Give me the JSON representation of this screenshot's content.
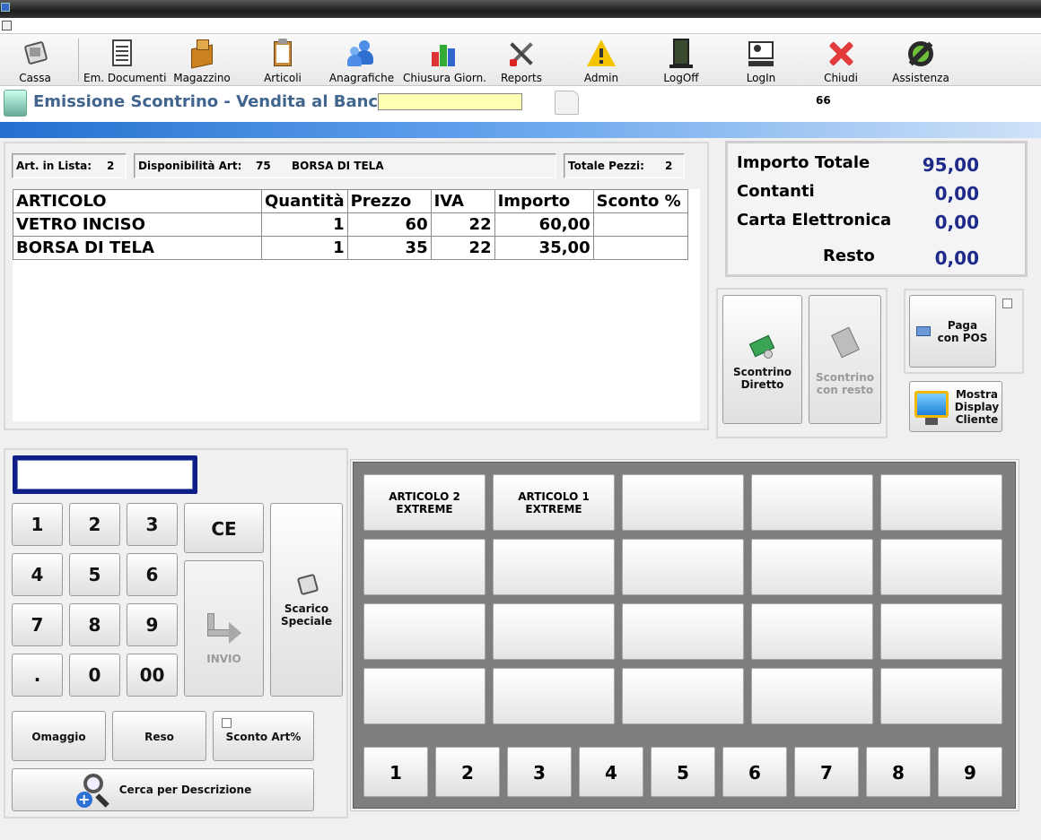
{
  "toolbar": {
    "items": [
      {
        "label": "Cassa",
        "icon": "cash-register-icon"
      },
      {
        "label": "Em. Documenti",
        "icon": "document-icon"
      },
      {
        "label": "Magazzino",
        "icon": "warehouse-box-icon"
      },
      {
        "label": "Articoli",
        "icon": "clipboard-icon"
      },
      {
        "label": "Anagrafiche",
        "icon": "people-icon"
      },
      {
        "label": "Chiusura Giorn.",
        "icon": "daily-closing-icon"
      },
      {
        "label": "Reports",
        "icon": "tools-icon"
      },
      {
        "label": "Admin",
        "icon": "warning-icon"
      },
      {
        "label": "LogOff",
        "icon": "logoff-door-icon"
      },
      {
        "label": "LogIn",
        "icon": "login-icon"
      },
      {
        "label": "Chiudi",
        "icon": "close-x-icon"
      },
      {
        "label": "Assistenza",
        "icon": "assistance-icon"
      }
    ]
  },
  "header": {
    "title": "Emissione Scontrino - Vendita al Banco",
    "input_value": "",
    "number": "66"
  },
  "info": {
    "art_lista_label": "Art. in Lista:",
    "art_lista_value": "2",
    "disp_label": "Disponibilità Art:",
    "disp_value": "75",
    "disp_name": "BORSA DI TELA",
    "tot_pezzi_label": "Totale Pezzi:",
    "tot_pezzi_value": "2"
  },
  "table": {
    "headers": [
      "ARTICOLO",
      "Quantità",
      "Prezzo",
      "IVA",
      "Importo",
      "Sconto %"
    ],
    "rows": [
      [
        "VETRO INCISO",
        "1",
        "60",
        "22",
        "60,00",
        ""
      ],
      [
        "BORSA DI TELA",
        "1",
        "35",
        "22",
        "35,00",
        ""
      ]
    ]
  },
  "totals": {
    "importo_label": "Importo Totale",
    "importo_value": "95,00",
    "contanti_label": "Contanti",
    "contanti_value": "0,00",
    "carta_label": "Carta Elettronica",
    "carta_value": "0,00",
    "resto_label": "Resto",
    "resto_value": "0,00"
  },
  "actions": {
    "scontrino_diretto": "Scontrino Diretto",
    "scontrino_resto": "Scontrino con resto",
    "paga_pos": "Paga con POS",
    "mostra_display": "Mostra Display Cliente"
  },
  "keypad": {
    "input_value": "",
    "keys": [
      "1",
      "2",
      "3",
      "4",
      "5",
      "6",
      "7",
      "8",
      "9",
      ".",
      "0",
      "00"
    ],
    "ce": "CE",
    "invio": "INVIO",
    "scarico": "Scarico Speciale",
    "omaggio": "Omaggio",
    "reso": "Reso",
    "sconto_art": "Sconto Art%",
    "cerca": "Cerca per Descrizione"
  },
  "grid_buttons": [
    "ARTICOLO 2 EXTREME",
    "ARTICOLO 1 EXTREME",
    "",
    "",
    "",
    "",
    "",
    "",
    "",
    "",
    "",
    "",
    "",
    "",
    "",
    "",
    "",
    "",
    "",
    ""
  ],
  "page_buttons": [
    "1",
    "2",
    "3",
    "4",
    "5",
    "6",
    "7",
    "8",
    "9"
  ]
}
